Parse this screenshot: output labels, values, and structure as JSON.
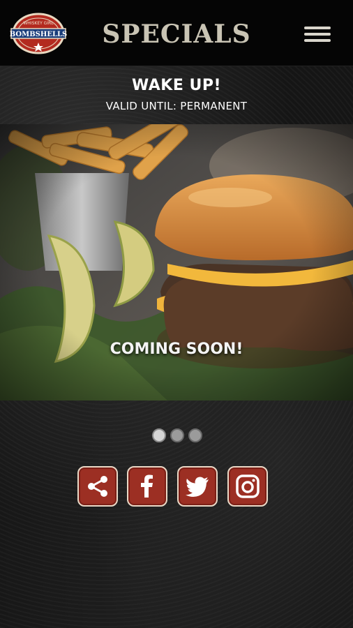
{
  "header": {
    "logo_text": "BOMBSHELLS",
    "logo_subtext": "WHISKEY GIRL",
    "title": "SPECIALS",
    "menu_icon": "hamburger-menu-icon"
  },
  "special": {
    "title": "WAKE UP!",
    "valid": "VALID UNTIL: PERMANENT",
    "caption": "COMING SOON!"
  },
  "carousel": {
    "count": 3,
    "active_index": 0
  },
  "social": {
    "icons": [
      "share-icon",
      "facebook-icon",
      "twitter-icon",
      "instagram-icon"
    ]
  },
  "colors": {
    "brand_red": "#9c2f23",
    "title_beige": "#c9c4b4",
    "icon_border": "#e9d9c7"
  }
}
